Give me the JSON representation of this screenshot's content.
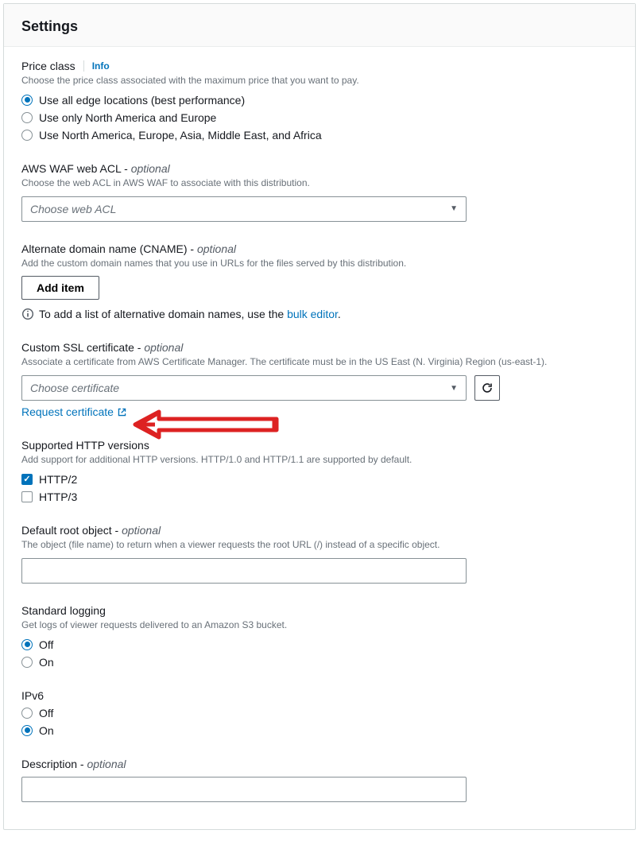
{
  "header": {
    "title": "Settings"
  },
  "price_class": {
    "label": "Price class",
    "info": "Info",
    "desc": "Choose the price class associated with the maximum price that you want to pay.",
    "options": [
      "Use all edge locations (best performance)",
      "Use only North America and Europe",
      "Use North America, Europe, Asia, Middle East, and Africa"
    ],
    "selected": 0
  },
  "waf": {
    "label": "AWS WAF web ACL",
    "optional": "optional",
    "desc": "Choose the web ACL in AWS WAF to associate with this distribution.",
    "placeholder": "Choose web ACL"
  },
  "cname": {
    "label": "Alternate domain name (CNAME)",
    "optional": "optional",
    "desc": "Add the custom domain names that you use in URLs for the files served by this distribution.",
    "button": "Add item",
    "infoText": "To add a list of alternative domain names, use the ",
    "bulkLink": "bulk editor",
    "period": "."
  },
  "ssl": {
    "label": "Custom SSL certificate",
    "optional": "optional",
    "desc": "Associate a certificate from AWS Certificate Manager. The certificate must be in the US East (N. Virginia) Region (us-east-1).",
    "placeholder": "Choose certificate",
    "requestLink": "Request certificate"
  },
  "http": {
    "label": "Supported HTTP versions",
    "desc": "Add support for additional HTTP versions. HTTP/1.0 and HTTP/1.1 are supported by default.",
    "options": [
      "HTTP/2",
      "HTTP/3"
    ],
    "checked": [
      true,
      false
    ]
  },
  "root": {
    "label": "Default root object",
    "optional": "optional",
    "desc": "The object (file name) to return when a viewer requests the root URL (/) instead of a specific object.",
    "value": ""
  },
  "logging": {
    "label": "Standard logging",
    "desc": "Get logs of viewer requests delivered to an Amazon S3 bucket.",
    "options": [
      "Off",
      "On"
    ],
    "selected": 0
  },
  "ipv6": {
    "label": "IPv6",
    "options": [
      "Off",
      "On"
    ],
    "selected": 1
  },
  "description": {
    "label": "Description",
    "optional": "optional",
    "value": ""
  },
  "colors": {
    "link": "#0073bb",
    "annotation": "#d22"
  }
}
